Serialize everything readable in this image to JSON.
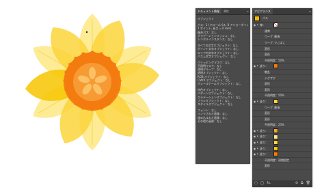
{
  "colors": {
    "petal_light": "#fde98a",
    "petal_mid": "#fbd53c",
    "petal_dark": "#f7c600",
    "corona_outer": "#f47b0f",
    "corona_inner": "#f7a23d",
    "panel_bg": "#4a4a4a"
  },
  "doc_panel": {
    "tabs": [
      "ドキュメント情報",
      "属性"
    ],
    "lines": [
      "オブジェクト",
      "",
      "パス：1 (クローズパス, 8 アンカーポイント,",
      "7 ポイント, 長さ = 0 mm)",
      "複合パス：なし",
      "グラデーションメッシュ：なし",
      "シンボルインスタンス：なし",
      "",
      "すべての文字オブジェクト：なし",
      "ポイント文字オブジェクト：なし",
      "エリア内文字オブジェクト：なし",
      "パス上文字オブジェクト：なし",
      "",
      "クリッピングマスク：なし",
      "不透明マスク：なし",
      "透明グループ：なし",
      "透明オブジェクト：なし",
      "RGB オブジェクト：なし",
      "CMYK オブジェクト：なし",
      "グレースケールオブジェクト：なし",
      "",
      "特色オブジェクト：なし",
      "パターンオブジェクト：なし",
      "グラデーションオブジェクト：なし",
      "ブラシオブジェクト：なし",
      "スタイルオブジェクト：なし",
      "",
      "フォント：なし",
      "リンクされた画像：なし",
      "埋め込まれた画像：なし",
      "その他の画像：なし"
    ]
  },
  "app_panel": {
    "tab": "アピアランス",
    "header_label": "パス",
    "rows": [
      {
        "kind": "stroke",
        "label": "線：",
        "chip": "stroke",
        "value": ""
      },
      {
        "kind": "sub",
        "label": "",
        "value": "通常"
      },
      {
        "kind": "sub",
        "label": "",
        "value": "ワープ: 膨張"
      },
      {
        "kind": "sub",
        "label": "",
        "value": "ワープ: でこぼこ"
      },
      {
        "kind": "sub",
        "label": "",
        "value": "変形"
      },
      {
        "kind": "sub",
        "label": "",
        "value": "変形"
      },
      {
        "kind": "sub",
        "label": "",
        "value": "不透明度：50%"
      },
      {
        "kind": "fill",
        "label": "塗り：",
        "chip": "#f47b0f",
        "value": ""
      },
      {
        "kind": "sub",
        "label": "",
        "value": "散乱"
      },
      {
        "kind": "sub",
        "label": "",
        "value": "ジグザグ"
      },
      {
        "kind": "sub",
        "label": "",
        "value": "変形"
      },
      {
        "kind": "sub",
        "label": "",
        "value": "変形"
      },
      {
        "kind": "sub",
        "label": "",
        "value": "不透明度：50%"
      },
      {
        "kind": "fill",
        "label": "塗り：",
        "chip": "#fbd53c",
        "value": ""
      },
      {
        "kind": "sub",
        "label": "",
        "value": "ワープ: 膨張"
      },
      {
        "kind": "sub",
        "label": "",
        "value": "変形"
      },
      {
        "kind": "sub",
        "label": "",
        "value": "変形"
      },
      {
        "kind": "sub",
        "label": "",
        "value": "不透明度：23%"
      },
      {
        "kind": "fill",
        "label": "塗り：",
        "chip": "#f7a23d",
        "value": ""
      },
      {
        "kind": "fill",
        "label": "塗り：",
        "chip": "#fde98a",
        "value": ""
      },
      {
        "kind": "fill",
        "label": "塗り：",
        "chip": "#fbd53c",
        "value": ""
      },
      {
        "kind": "fill",
        "label": "塗り：",
        "chip": "#f7c600",
        "value": ""
      },
      {
        "kind": "fill",
        "label": "塗り：",
        "chip": "#f47b0f",
        "value": ""
      },
      {
        "kind": "sub",
        "label": "",
        "value": "不透明度：初期設定"
      },
      {
        "kind": "sub",
        "label": "",
        "value": "変形"
      }
    ],
    "footer": {
      "fx": "fx.",
      "trash": "🗑"
    }
  }
}
